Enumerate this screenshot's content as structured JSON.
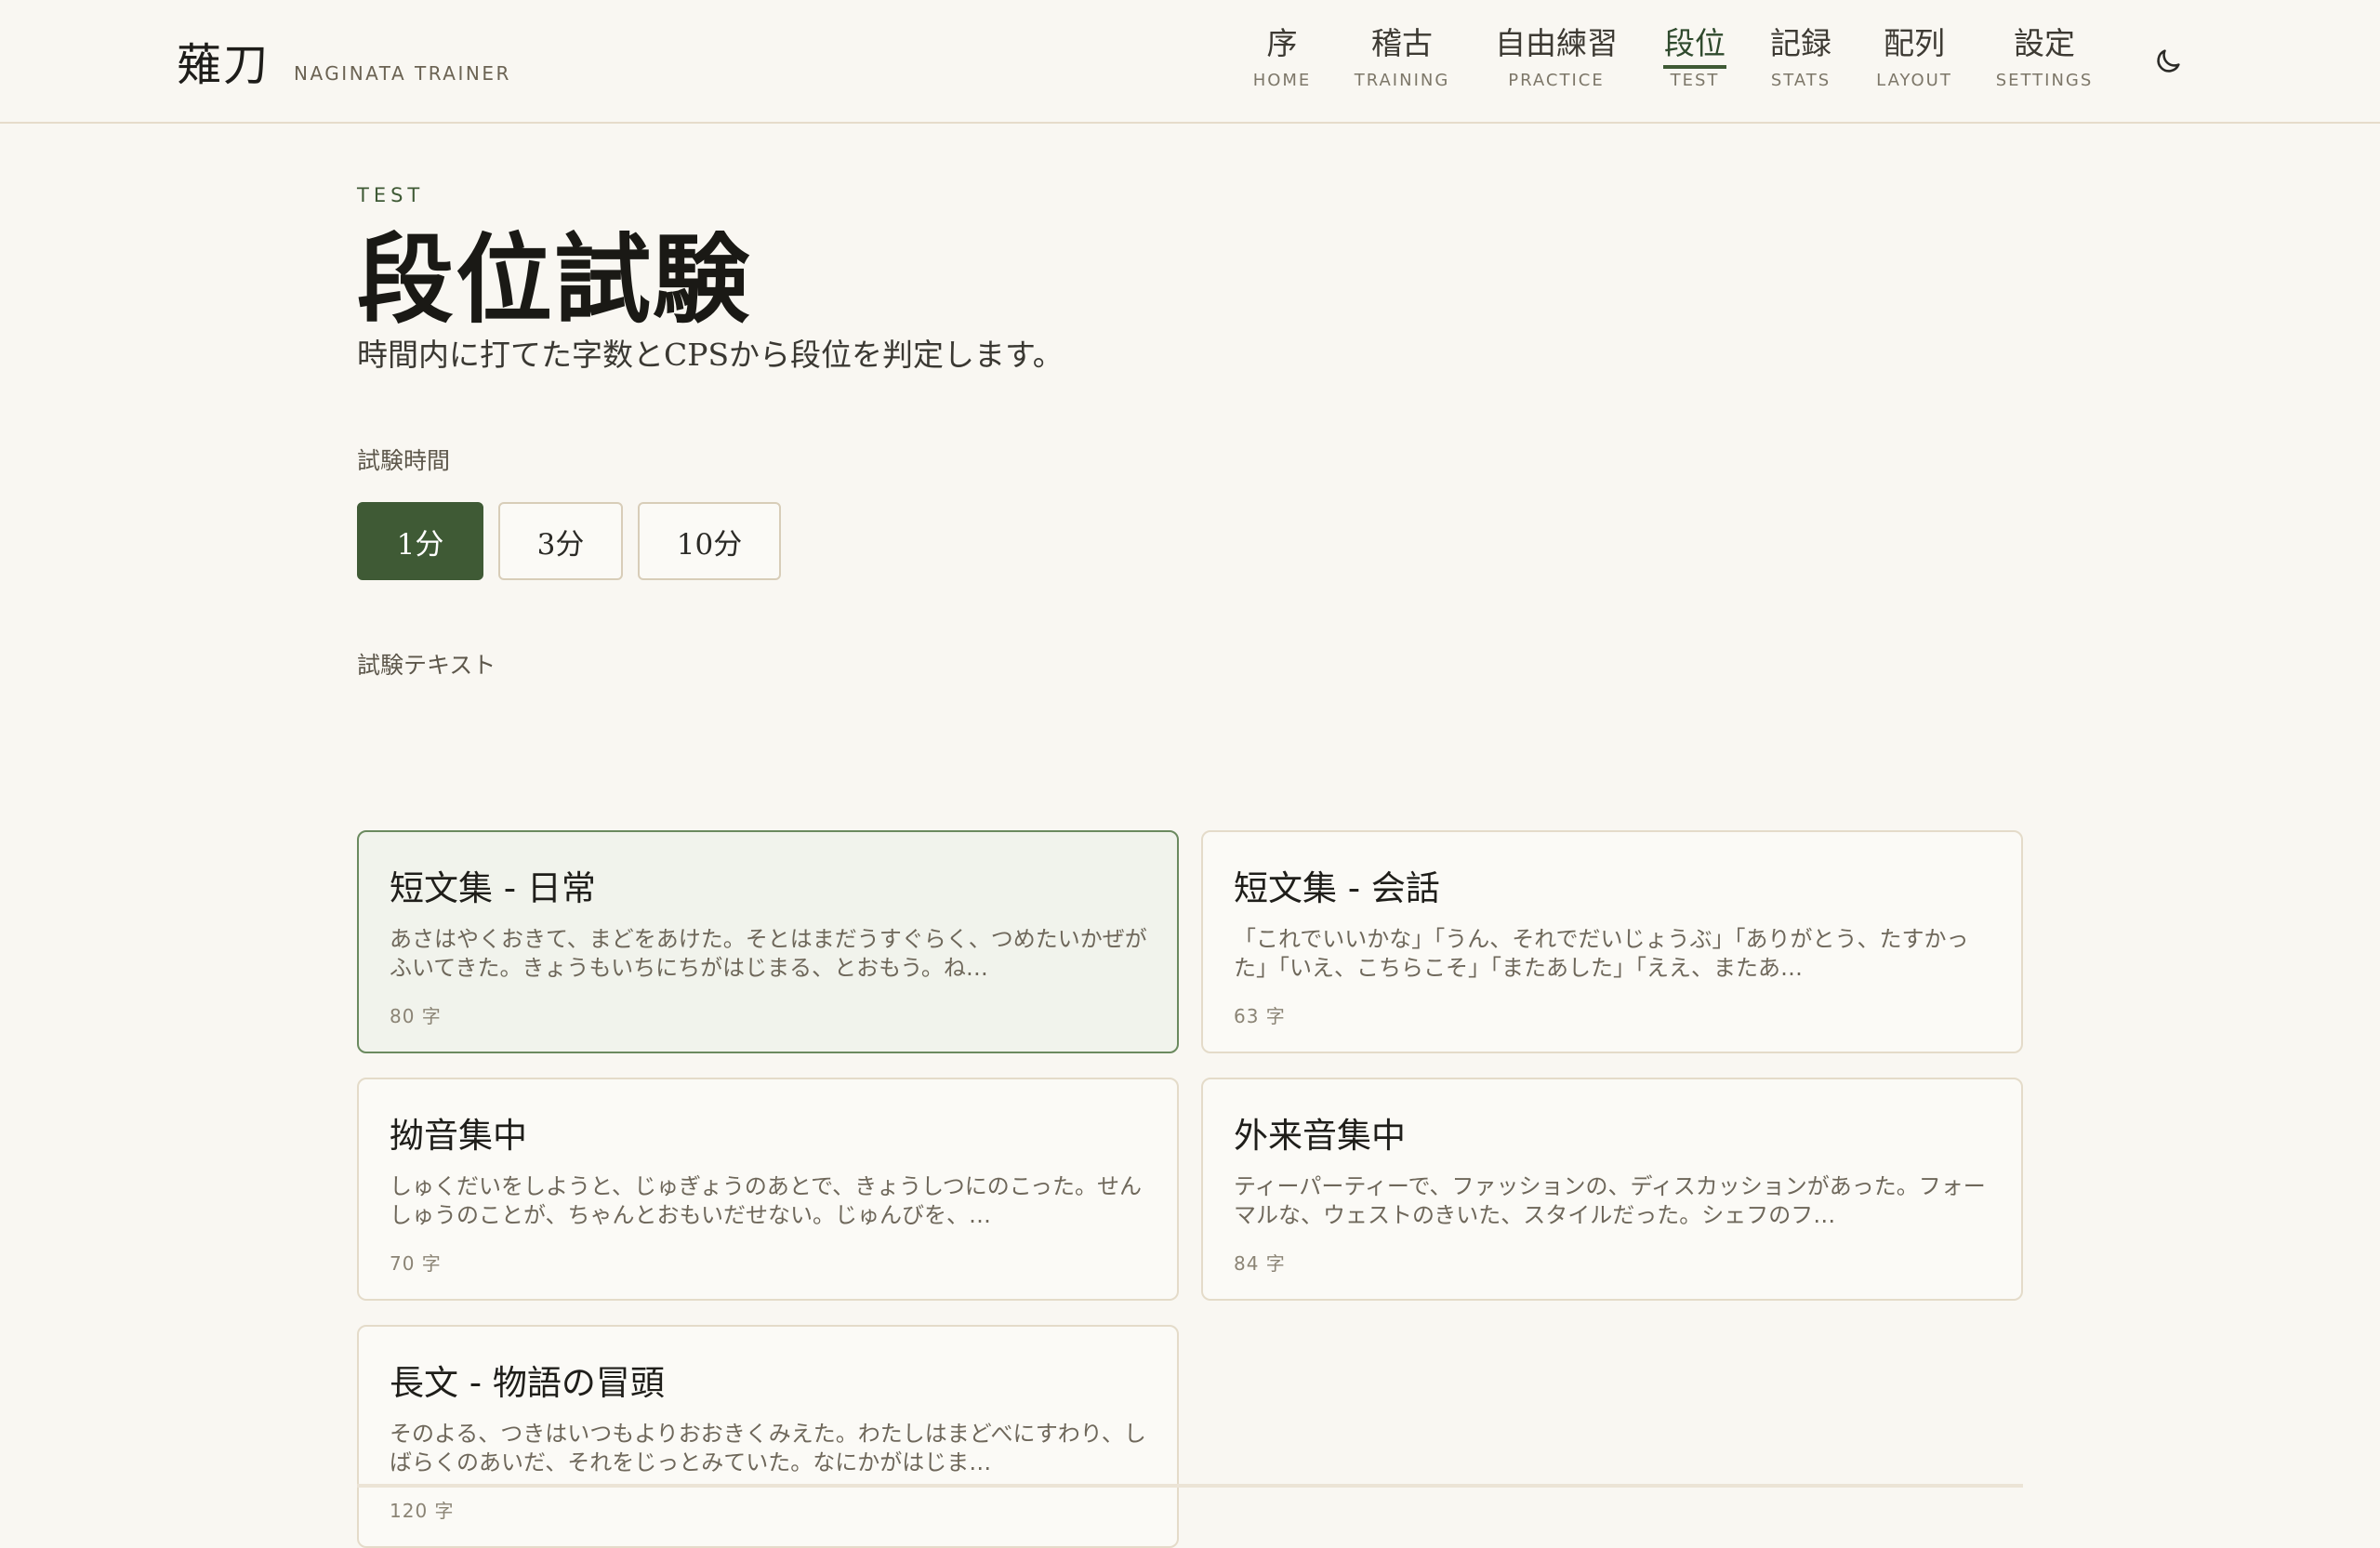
{
  "brand": {
    "kanji": "薙刀",
    "subtitle": "NAGINATA TRAINER"
  },
  "nav": [
    {
      "jp": "序",
      "en": "HOME",
      "active": false
    },
    {
      "jp": "稽古",
      "en": "TRAINING",
      "active": false
    },
    {
      "jp": "自由練習",
      "en": "PRACTICE",
      "active": false
    },
    {
      "jp": "段位",
      "en": "TEST",
      "active": true
    },
    {
      "jp": "記録",
      "en": "STATS",
      "active": false
    },
    {
      "jp": "配列",
      "en": "LAYOUT",
      "active": false
    },
    {
      "jp": "設定",
      "en": "SETTINGS",
      "active": false
    }
  ],
  "theme_toggle_icon": "moon-icon",
  "page": {
    "eyebrow": "TEST",
    "title": "段位試験",
    "description": "時間内に打てた字数とCPSから段位を判定します。"
  },
  "duration": {
    "label": "試験時間",
    "options": [
      "1分",
      "3分",
      "10分"
    ],
    "selected": "1分"
  },
  "texts": {
    "label": "試験テキスト",
    "items": [
      {
        "title": "短文集 - 日常",
        "preview": "あさはやくおきて、まどをあけた。そとはまだうすぐらく、つめたいかぜがふいてきた。きょうもいちにちがはじまる、とおもう。ね…",
        "count": "80 字",
        "selected": true
      },
      {
        "title": "短文集 - 会話",
        "preview": "「これでいいかな」「うん、それでだいじょうぶ」「ありがとう、たすかった」「いえ、こちらこそ」「またあした」「ええ、またあ…",
        "count": "63 字",
        "selected": false
      },
      {
        "title": "拗音集中",
        "preview": "しゅくだいをしようと、じゅぎょうのあとで、きょうしつにのこった。せんしゅうのことが、ちゃんとおもいだせない。じゅんびを、…",
        "count": "70 字",
        "selected": false
      },
      {
        "title": "外来音集中",
        "preview": "ティーパーティーで、ファッションの、ディスカッションがあった。フォーマルな、ウェストのきいた、スタイルだった。シェフのフ…",
        "count": "84 字",
        "selected": false
      },
      {
        "title": "長文 - 物語の冒頭",
        "preview": "そのよる、つきはいつもよりおおきくみえた。わたしはまどべにすわり、しばらくのあいだ、それをじっとみていた。なにかがはじま…",
        "count": "120 字",
        "selected": false
      }
    ]
  },
  "colors": {
    "accent": "#3f5a35",
    "background": "#f9f7f2",
    "selected_card_bg": "#f1f3ec",
    "border": "#e4dbc9"
  }
}
